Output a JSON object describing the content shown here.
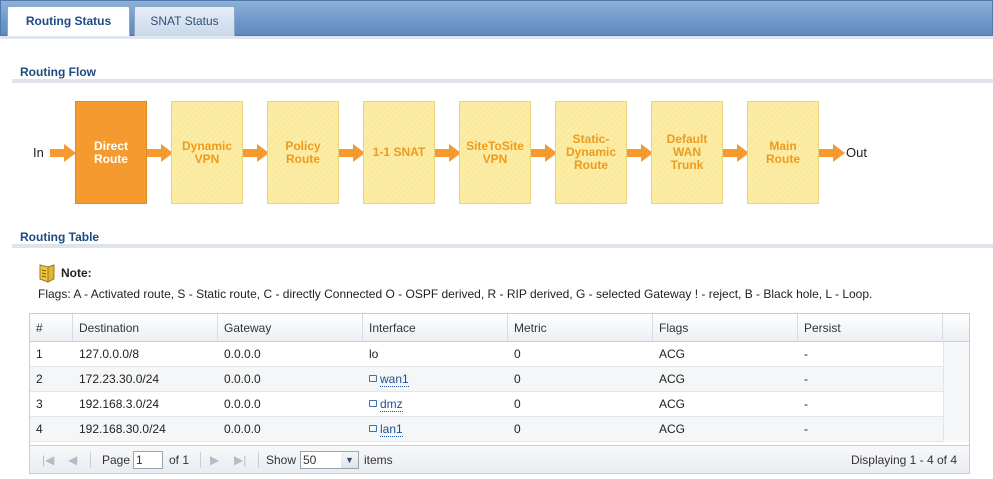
{
  "tabs": [
    {
      "label": "Routing Status",
      "active": true
    },
    {
      "label": "SNAT Status",
      "active": false
    }
  ],
  "routing_flow": {
    "title": "Routing Flow",
    "in_label": "In",
    "out_label": "Out",
    "steps": [
      {
        "label": "Direct\nRoute",
        "active": true
      },
      {
        "label": "Dynamic\nVPN",
        "active": false
      },
      {
        "label": "Policy\nRoute",
        "active": false
      },
      {
        "label": "1-1 SNAT",
        "active": false
      },
      {
        "label": "SiteToSite\nVPN",
        "active": false
      },
      {
        "label": "Static-\nDynamic\nRoute",
        "active": false
      },
      {
        "label": "Default\nWAN\nTrunk",
        "active": false
      },
      {
        "label": "Main\nRoute",
        "active": false
      }
    ],
    "colors": {
      "active": "#f49a2f",
      "inactive": "#fbeea8",
      "arrow": "#f49a2f"
    }
  },
  "routing_table": {
    "title": "Routing Table",
    "note_title": "Note:",
    "flags_text": "Flags: A - Activated route, S - Static route, C - directly Connected O - OSPF derived, R - RIP derived, G - selected Gateway ! - reject, B - Black hole, L - Loop.",
    "columns": [
      "#",
      "Destination",
      "Gateway",
      "Interface",
      "Metric",
      "Flags",
      "Persist"
    ],
    "rows": [
      {
        "num": "1",
        "destination": "127.0.0.0/8",
        "gateway": "0.0.0.0",
        "interface": "lo",
        "interface_link": false,
        "metric": "0",
        "flags": "ACG",
        "persist": "-"
      },
      {
        "num": "2",
        "destination": "172.23.30.0/24",
        "gateway": "0.0.0.0",
        "interface": "wan1",
        "interface_link": true,
        "metric": "0",
        "flags": "ACG",
        "persist": "-"
      },
      {
        "num": "3",
        "destination": "192.168.3.0/24",
        "gateway": "0.0.0.0",
        "interface": "dmz",
        "interface_link": true,
        "metric": "0",
        "flags": "ACG",
        "persist": "-"
      },
      {
        "num": "4",
        "destination": "192.168.30.0/24",
        "gateway": "0.0.0.0",
        "interface": "lan1",
        "interface_link": true,
        "metric": "0",
        "flags": "ACG",
        "persist": "-"
      }
    ],
    "pager": {
      "page_label": "Page",
      "page_value": "1",
      "of_label": "of 1",
      "show_label": "Show",
      "show_value": "50",
      "items_label": "items",
      "displaying": "Displaying 1 - 4 of 4"
    }
  }
}
